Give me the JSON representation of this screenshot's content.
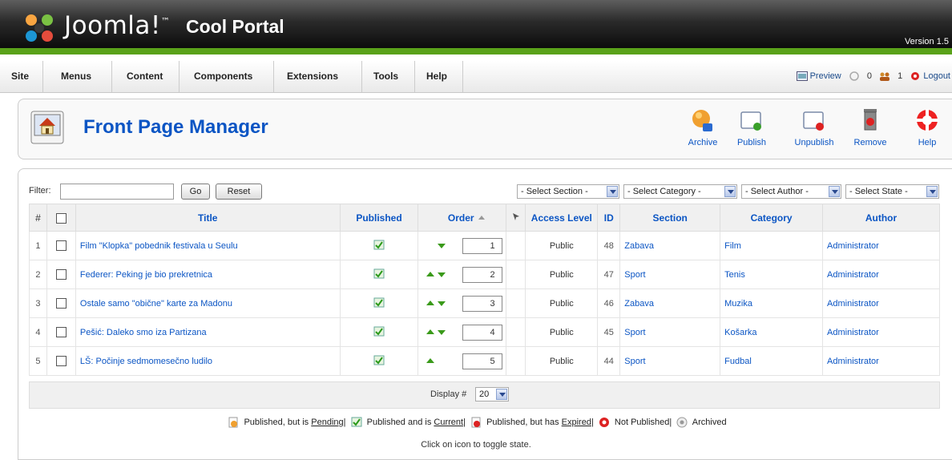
{
  "header": {
    "brand": "Joomla!",
    "trademark": "™",
    "site_name": "Cool Portal",
    "version": "Version 1.5"
  },
  "menu": {
    "items": [
      "Site",
      "Menus",
      "Content",
      "Components",
      "Extensions",
      "Tools",
      "Help"
    ],
    "preview": "Preview",
    "messages": "0",
    "users": "1",
    "logout": "Logout"
  },
  "toolbar": {
    "title": "Front Page Manager",
    "buttons": [
      "Archive",
      "Publish",
      "Unpublish",
      "Remove",
      "Help"
    ]
  },
  "filter": {
    "label": "Filter:",
    "value": "",
    "go": "Go",
    "reset": "Reset",
    "selects": [
      "- Select Section -",
      "- Select Category -",
      "- Select Author -",
      "- Select State -"
    ]
  },
  "table": {
    "headers": {
      "num": "#",
      "title": "Title",
      "published": "Published",
      "order": "Order",
      "access": "Access Level",
      "id": "ID",
      "section": "Section",
      "category": "Category",
      "author": "Author"
    },
    "rows": [
      {
        "num": "1",
        "title": "Film \"Klopka\" pobednik festivala u Seulu",
        "order": "1",
        "access": "Public",
        "id": "48",
        "section": "Zabava",
        "category": "Film",
        "author": "Administrator"
      },
      {
        "num": "2",
        "title": "Federer: Peking je bio prekretnica",
        "order": "2",
        "access": "Public",
        "id": "47",
        "section": "Sport",
        "category": "Tenis",
        "author": "Administrator"
      },
      {
        "num": "3",
        "title": "Ostale samo \"obične\" karte za Madonu",
        "order": "3",
        "access": "Public",
        "id": "46",
        "section": "Zabava",
        "category": "Muzika",
        "author": "Administrator"
      },
      {
        "num": "4",
        "title": "Pešić: Daleko smo iza Partizana",
        "order": "4",
        "access": "Public",
        "id": "45",
        "section": "Sport",
        "category": "Košarka",
        "author": "Administrator"
      },
      {
        "num": "5",
        "title": "LŠ: Počinje sedmomesečno ludilo",
        "order": "5",
        "access": "Public",
        "id": "44",
        "section": "Sport",
        "category": "Fudbal",
        "author": "Administrator"
      }
    ]
  },
  "pagination": {
    "display_label": "Display #",
    "display_value": "20"
  },
  "legend": {
    "pending_pre": "Published, but is ",
    "pending": "Pending",
    "current_pre": "Published and is ",
    "current": "Current",
    "expired_pre": "Published, but has ",
    "expired": "Expired",
    "not_published": "Not Published",
    "archived": "Archived",
    "sep": "|",
    "hint": "Click on icon to toggle state."
  }
}
